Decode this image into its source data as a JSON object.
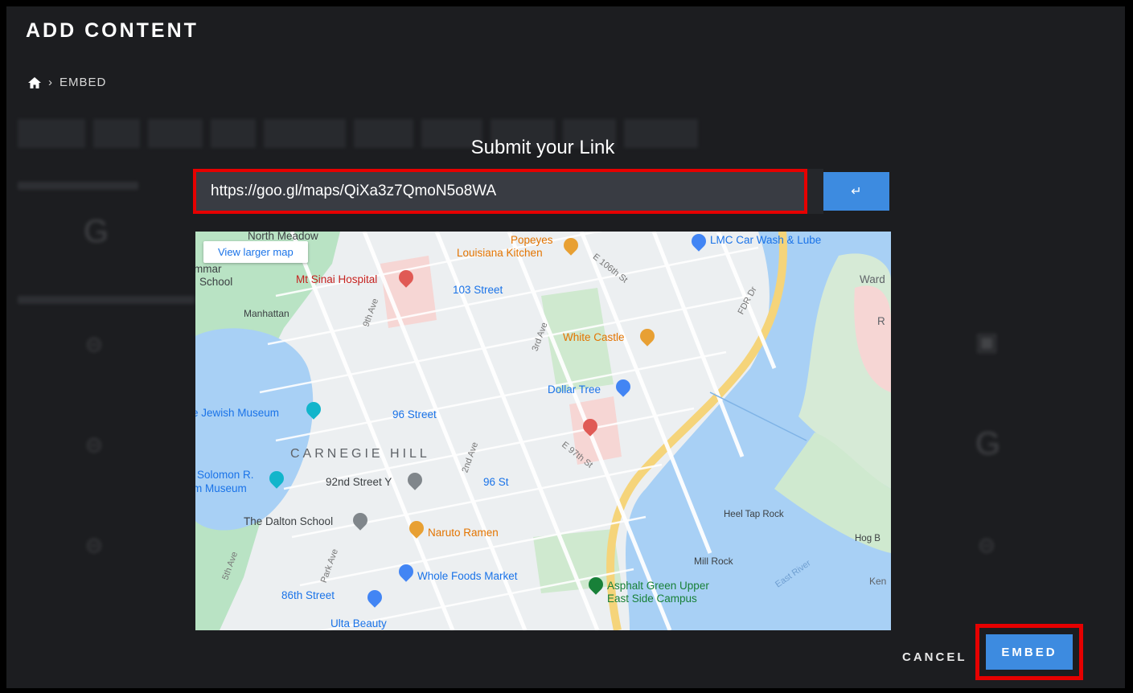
{
  "header": {
    "title": "ADD CONTENT"
  },
  "breadcrumb": {
    "home_icon": "home-icon",
    "separator": "›",
    "current": "EMBED"
  },
  "dialog": {
    "title": "Submit your Link",
    "url_value": "https://goo.gl/maps/QiXa3z7QmoN5o8WA",
    "submit_icon": "enter-arrow-icon",
    "submit_glyph": "↵"
  },
  "map": {
    "view_larger": "View larger map",
    "labels": {
      "north_meadow": "North Meadow",
      "popeyes": "Popeyes",
      "louisiana_kitchen": "Louisiana Kitchen",
      "lmc": "LMC Car Wash & Lube",
      "wards": "Ward",
      "grammar": "mmar",
      "school": "School",
      "mt_sinai": "Mt Sinai Hospital",
      "st103": "103 Street",
      "manhattan": "Manhattan",
      "white_castle": "White Castle",
      "dollar_tree": "Dollar Tree",
      "jewish_museum": "e Jewish Museum",
      "st96": "96 Street",
      "carnegie_hill": "CARNEGIE HILL",
      "solomon": "Solomon R.",
      "museum": "m Museum",
      "st92": "92nd Street Y",
      "st96b": "96 St",
      "dalton": "The Dalton School",
      "naruto": "Naruto Ramen",
      "whole_foods": "Whole Foods Market",
      "st86": "86th Street",
      "ulta": "Ulta Beauty",
      "heel_tap": "Heel Tap Rock",
      "hog": "Hog B",
      "mill_rock": "Mill Rock",
      "asphalt": "Asphalt Green Upper",
      "east_side": "East Side Campus",
      "fdr": "FDR Dr",
      "e106": "E 106th St",
      "e97": "E 97th St",
      "ave5": "5th Ave",
      "ave3": "3rd Ave",
      "park": "Park Ave",
      "ave2": "2nd Ave",
      "ave9": "9th Ave",
      "east_river": "East River",
      "ken": "Ken",
      "r": "R"
    }
  },
  "footer": {
    "cancel_label": "CANCEL",
    "embed_label": "EMBED"
  },
  "colors": {
    "accent": "#3d8be0",
    "highlight": "#e60000",
    "background": "#1c1d20"
  }
}
